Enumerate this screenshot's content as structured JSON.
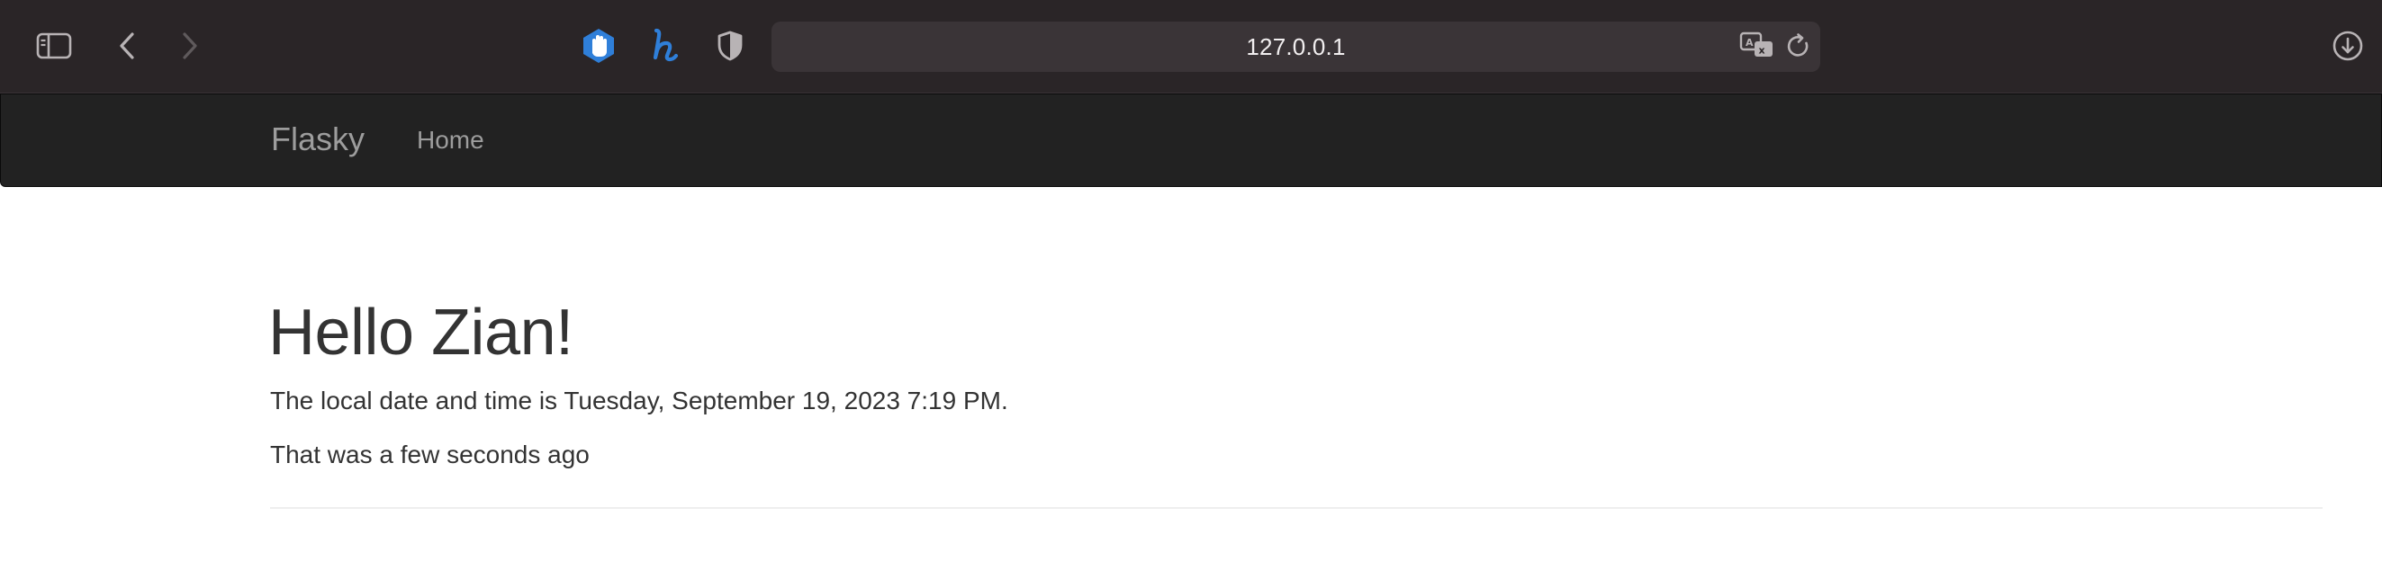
{
  "browser": {
    "address": "127.0.0.1",
    "icons": {
      "sidebar": "sidebar-icon",
      "back": "chevron-left-icon",
      "forward": "chevron-right-icon",
      "ublock": "ublock-hand-icon",
      "honey": "honey-h-icon",
      "shield": "privacy-shield-icon",
      "translate": "translate-icon",
      "reload": "reload-icon",
      "download": "download-icon"
    },
    "colors": {
      "toolbar_bg": "#2a2527",
      "address_bg": "#3a3437",
      "extension_blue": "#2f7fd9"
    }
  },
  "navbar": {
    "brand": "Flasky",
    "items": [
      {
        "label": "Home"
      }
    ],
    "colors": {
      "bg": "#222222",
      "text": "#9d9d9d"
    }
  },
  "main": {
    "heading": "Hello Zian!",
    "datetime_text": "The local date and time is Tuesday, September 19, 2023 7:19 PM.",
    "relative_text": "That was a few seconds ago"
  }
}
